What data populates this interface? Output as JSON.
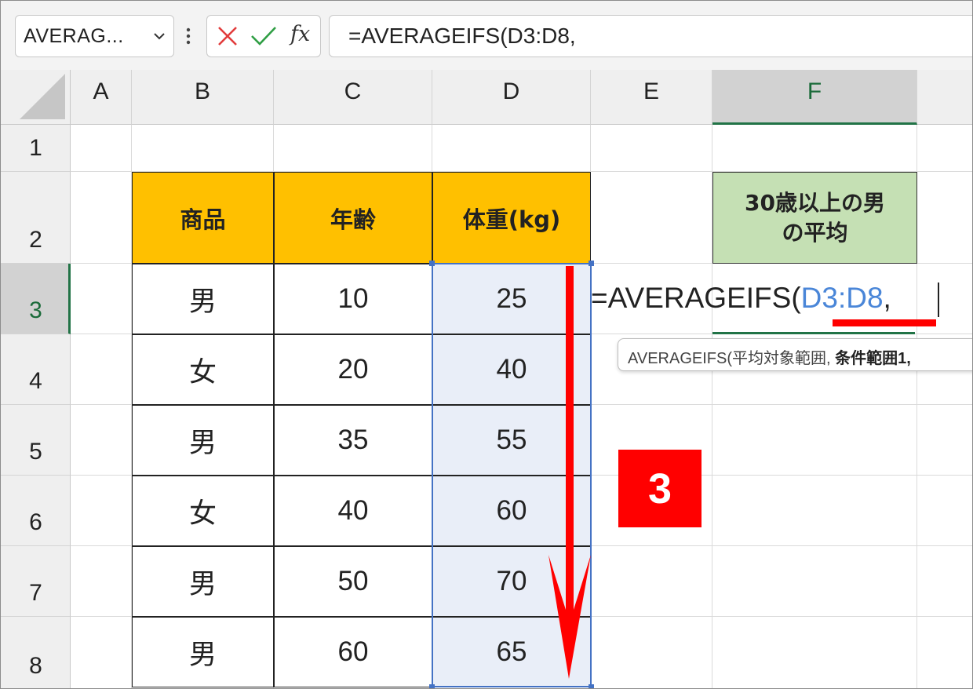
{
  "name_box": {
    "value": "AVERAG..."
  },
  "formula_bar": {
    "formula": "=AVERAGEIFS(D3:D8,",
    "fx_label": "fx"
  },
  "columns": [
    "A",
    "B",
    "C",
    "D",
    "E",
    "F"
  ],
  "rows": [
    "1",
    "2",
    "3",
    "4",
    "5",
    "6",
    "7",
    "8"
  ],
  "selected_column": "F",
  "selected_row": "3",
  "table": {
    "headers": [
      "商品",
      "年齢",
      "体重(kg)"
    ],
    "rows": [
      [
        "男",
        "10",
        "25"
      ],
      [
        "女",
        "20",
        "40"
      ],
      [
        "男",
        "35",
        "55"
      ],
      [
        "女",
        "40",
        "60"
      ],
      [
        "男",
        "50",
        "70"
      ],
      [
        "男",
        "60",
        "65"
      ]
    ]
  },
  "result_label": {
    "line1": "30歳以上の男",
    "line2": "の平均"
  },
  "cell_edit": {
    "prefix": "=AVERAGEIFS(",
    "ref": "D3:D8",
    "suffix": ","
  },
  "tooltip": {
    "normal": "AVERAGEIFS(平均対象範囲, ",
    "bold": "条件範囲1, "
  },
  "step_badge": "3",
  "colors": {
    "header_fill": "#ffc000",
    "result_fill": "#c5e0b4",
    "selection_border": "#4472c4",
    "reference_text": "#4a86d8",
    "annotation_red": "#ff0000",
    "excel_green": "#217346"
  }
}
